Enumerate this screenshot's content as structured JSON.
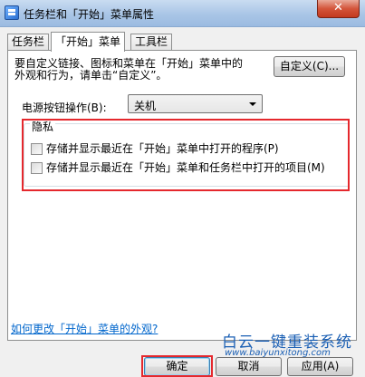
{
  "window": {
    "title": "任务栏和「开始」菜单属性",
    "close_label": "✕",
    "icon": "taskbar-properties-icon"
  },
  "tabs": [
    {
      "label": "任务栏",
      "active": false
    },
    {
      "label": "「开始」菜单",
      "active": true
    },
    {
      "label": "工具栏",
      "active": false
    }
  ],
  "start_menu": {
    "description_lines": [
      "要自定义链接、图标和菜单在「开始」菜单中的",
      "外观和行为，请单击“自定义”。"
    ],
    "customize_button": "自定义(C)...",
    "power_label": "电源按钮操作(B):",
    "power_value": "关机"
  },
  "privacy": {
    "legend": "隐私",
    "options": [
      {
        "label": "存储并显示最近在「开始」菜单中打开的程序(P)",
        "checked": false
      },
      {
        "label": "存储并显示最近在「开始」菜单和任务栏中打开的项目(M)",
        "checked": false
      }
    ]
  },
  "help_link": "如何更改「开始」菜单的外观?",
  "buttons": {
    "ok": "确定",
    "cancel": "取消",
    "apply": "应用(A)"
  },
  "watermark": {
    "title": "白云一键重装系统",
    "url": "www.baiyunxitong.com"
  },
  "colors": {
    "highlight": "#e5282d",
    "link": "#0066cc",
    "watermark": "#1a5fb4"
  }
}
